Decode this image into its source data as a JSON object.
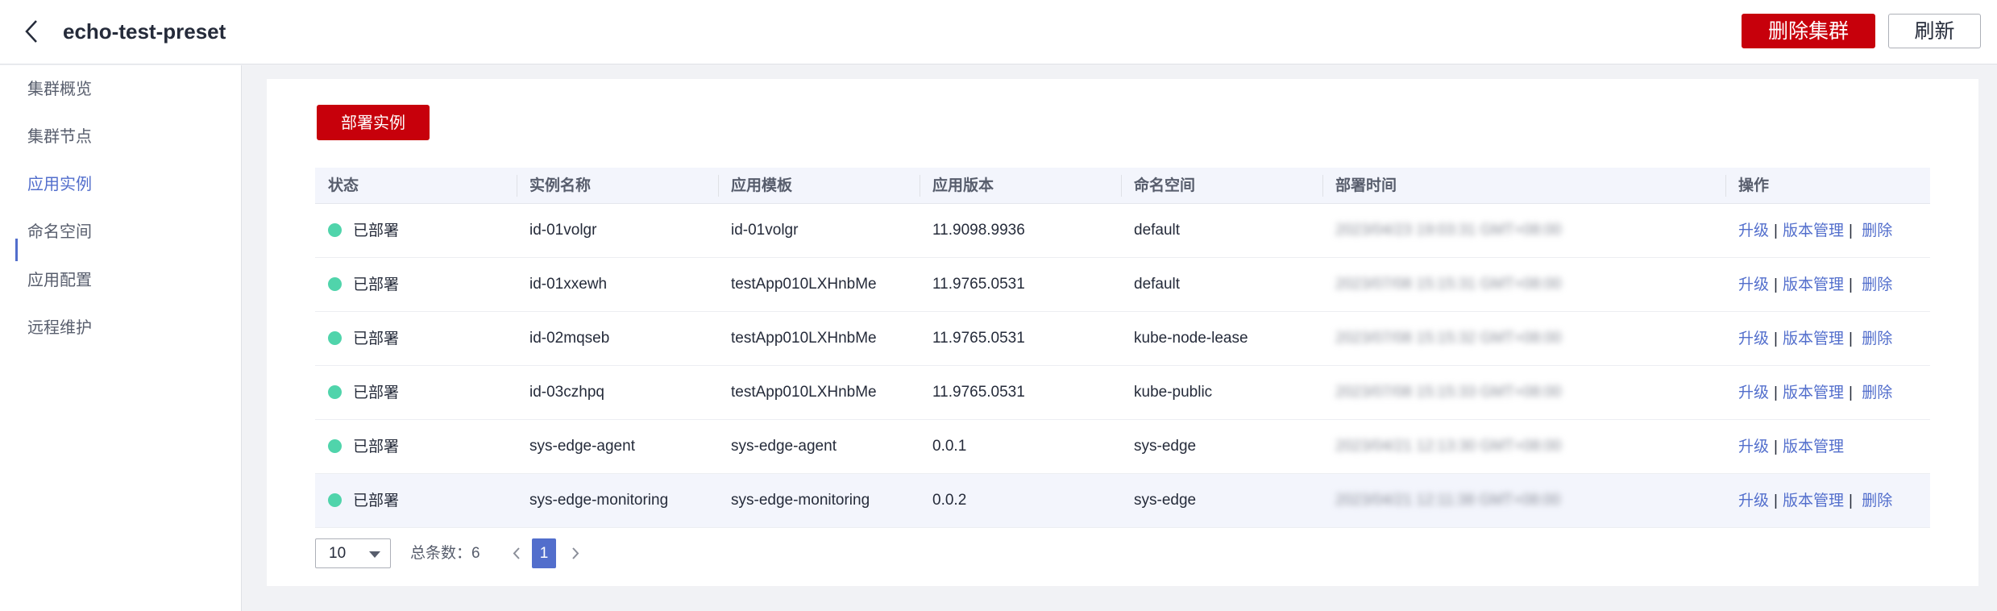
{
  "header": {
    "title": "echo-test-preset",
    "delete_cluster_label": "删除集群",
    "refresh_label": "刷新"
  },
  "sidebar": {
    "items": [
      {
        "label": "集群概览",
        "active": false
      },
      {
        "label": "集群节点",
        "active": false
      },
      {
        "label": "应用实例",
        "active": true
      },
      {
        "label": "命名空间",
        "active": false
      },
      {
        "label": "应用配置",
        "active": false
      },
      {
        "label": "远程维护",
        "active": false
      }
    ]
  },
  "main": {
    "deploy_button_label": "部署实例",
    "table": {
      "columns": [
        "状态",
        "实例名称",
        "应用模板",
        "应用版本",
        "命名空间",
        "部署时间",
        "操作"
      ],
      "rows": [
        {
          "status": "已部署",
          "name": "id-01volgr",
          "template": "id-01volgr",
          "version": "11.9098.9936",
          "namespace": "default",
          "deploy_time": "2023/04/23 19:03:31 GMT+08:00",
          "ops": [
            "升级",
            "版本管理",
            "删除"
          ]
        },
        {
          "status": "已部署",
          "name": "id-01xxewh",
          "template": "testApp010LXHnbMe",
          "version": "11.9765.0531",
          "namespace": "default",
          "deploy_time": "2023/07/08 15:15:31 GMT+08:00",
          "ops": [
            "升级",
            "版本管理",
            "删除"
          ]
        },
        {
          "status": "已部署",
          "name": "id-02mqseb",
          "template": "testApp010LXHnbMe",
          "version": "11.9765.0531",
          "namespace": "kube-node-lease",
          "deploy_time": "2023/07/08 15:15:32 GMT+08:00",
          "ops": [
            "升级",
            "版本管理",
            "删除"
          ]
        },
        {
          "status": "已部署",
          "name": "id-03czhpq",
          "template": "testApp010LXHnbMe",
          "version": "11.9765.0531",
          "namespace": "kube-public",
          "deploy_time": "2023/07/08 15:15:33 GMT+08:00",
          "ops": [
            "升级",
            "版本管理",
            "删除"
          ]
        },
        {
          "status": "已部署",
          "name": "sys-edge-agent",
          "template": "sys-edge-agent",
          "version": "0.0.1",
          "namespace": "sys-edge",
          "deploy_time": "2023/04/21 12:13:30 GMT+08:00",
          "ops": [
            "升级",
            "版本管理"
          ]
        },
        {
          "status": "已部署",
          "name": "sys-edge-monitoring",
          "template": "sys-edge-monitoring",
          "version": "0.0.2",
          "namespace": "sys-edge",
          "deploy_time": "2023/04/21 12:11:38 GMT+08:00",
          "ops": [
            "升级",
            "版本管理",
            "删除"
          ]
        }
      ]
    },
    "pagination": {
      "page_size": "10",
      "total_label": "总条数：",
      "total": "6",
      "current_page": "1"
    }
  },
  "colors": {
    "danger": "#c7000b",
    "link": "#526ecc",
    "status_deployed": "#50d4ab"
  }
}
